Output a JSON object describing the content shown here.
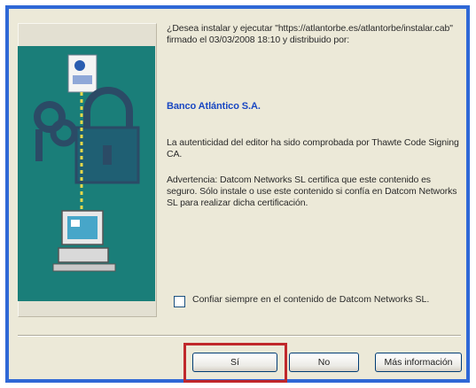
{
  "dialog": {
    "intro_text": "¿Desea instalar y ejecutar \"https://atlantorbe.es/atlantorbe/instalar.cab\" firmado el 03/03/2008 18:10 y distribuido por:",
    "publisher": "Banco Atlántico S.A.",
    "auth_text": "La autenticidad del editor ha sido comprobada por Thawte Code Signing CA.",
    "warning_text": "Advertencia: Datcom Networks SL certifica que este contenido es seguro. Sólo instale o use este contenido si confía en Datcom Networks SL para realizar dicha certificación.",
    "checkbox_label": "Confiar siempre en el contenido de Datcom Networks SL.",
    "checkbox_checked": false
  },
  "buttons": {
    "yes_label": "Sí",
    "no_label": "No",
    "more_label": "Más información"
  },
  "colors": {
    "accent": "#2f68d6",
    "panel": "#1a7e79",
    "highlight": "#c0282b",
    "publisher_text": "#1947c2"
  }
}
